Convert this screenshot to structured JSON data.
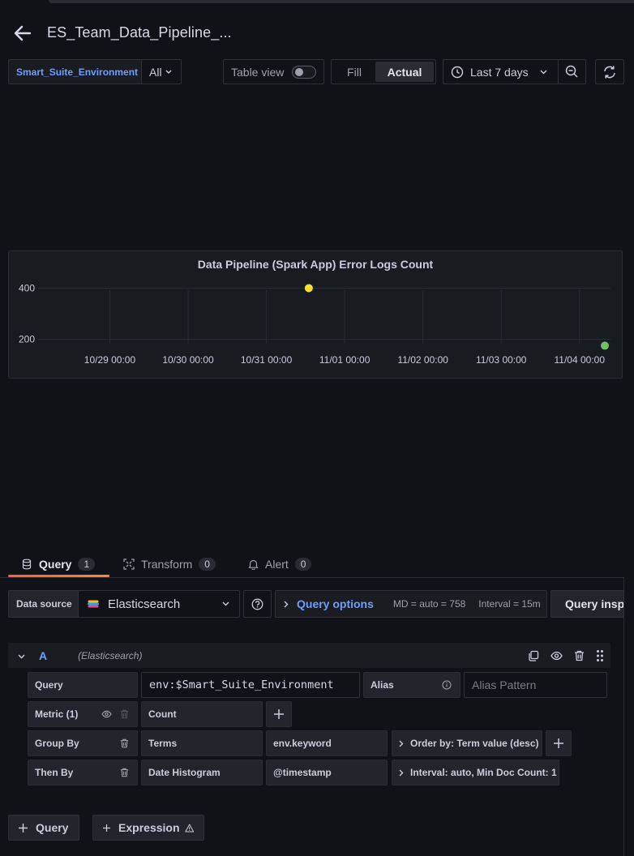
{
  "header": {
    "title": "ES_Team_Data_Pipeline_..."
  },
  "toolbar": {
    "variable_label": "Smart_Suite_Environment",
    "variable_value": "All",
    "table_view_label": "Table view",
    "fill_label": "Fill",
    "actual_label": "Actual",
    "time_range": "Last 7 days"
  },
  "panel": {
    "title": "Data Pipeline (Spark App) Error Logs Count"
  },
  "chart_data": {
    "type": "scatter",
    "title": "Data Pipeline (Spark App) Error Logs Count",
    "xlabel": "",
    "ylabel": "",
    "x_ticks": [
      "10/29 00:00",
      "10/30 00:00",
      "10/31 00:00",
      "11/01 00:00",
      "11/02 00:00",
      "11/03 00:00",
      "11/04 00:00"
    ],
    "y_ticks": [
      400,
      200
    ],
    "xlim": [
      "2024-10-28 03:00",
      "2024-11-04 09:30"
    ],
    "ylim": [
      170,
      430
    ],
    "grid": true,
    "series": [
      {
        "color": "#fade2a",
        "points": [
          {
            "x": "2024-10-31 13:00",
            "y": 400
          }
        ]
      },
      {
        "color": "#73bf69",
        "points": [
          {
            "x": "2024-11-04 10:00",
            "y": 175
          }
        ]
      }
    ]
  },
  "query_tabs": [
    {
      "label": "Query",
      "count": "1"
    },
    {
      "label": "Transform",
      "count": "0"
    },
    {
      "label": "Alert",
      "count": "0"
    }
  ],
  "datasource": {
    "label": "Data source",
    "name": "Elasticsearch",
    "options_title": "Query options",
    "md": "MD = auto = 758",
    "interval": "Interval = 15m",
    "inspector": "Query inspector"
  },
  "query_row": {
    "ref_id": "A",
    "datasource": "(Elasticsearch)",
    "query_label": "Query",
    "query_value": "env:$Smart_Suite_Environment",
    "alias_label": "Alias",
    "alias_placeholder": "Alias Pattern",
    "metric_label": "Metric (1)",
    "metric_value": "Count",
    "groupby_label": "Group By",
    "groupby_type": "Terms",
    "groupby_field": "env.keyword",
    "groupby_order": "Order by: Term value (desc)",
    "thenby_label": "Then By",
    "thenby_type": "Date Histogram",
    "thenby_field": "@timestamp",
    "thenby_interval": "Interval: auto, Min Doc Count: 1"
  },
  "bottom": {
    "add_query": "Query",
    "add_expression": "Expression"
  }
}
